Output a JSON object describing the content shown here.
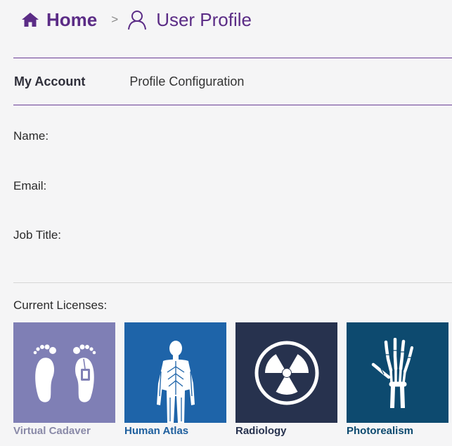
{
  "breadcrumb": {
    "home_icon": "home-icon",
    "home_label": "Home",
    "separator": ">",
    "user_icon": "user-icon",
    "current_label": "User Profile"
  },
  "tabs": [
    {
      "label": "My Account",
      "active": true
    },
    {
      "label": "Profile Configuration",
      "active": false
    }
  ],
  "fields": {
    "name_label": "Name:",
    "email_label": "Email:",
    "job_title_label": "Job Title:"
  },
  "licenses": {
    "heading": "Current Licenses:",
    "items": [
      {
        "label": "Virtual Cadaver",
        "icon": "feet-icon",
        "tile_color": "#7f7fb5",
        "label_color": "#8a8aa8"
      },
      {
        "label": "Human Atlas",
        "icon": "human-body-icon",
        "tile_color": "#1e64a9",
        "label_color": "#1e5f9e"
      },
      {
        "label": "Radiology",
        "icon": "radiation-icon",
        "tile_color": "#27324e",
        "label_color": "#27324e"
      },
      {
        "label": "Photorealism",
        "icon": "hand-xray-icon",
        "tile_color": "#0d4a6f",
        "label_color": "#0d4a6f"
      }
    ]
  },
  "colors": {
    "accent": "#5b2c86",
    "divider": "#6a3d96",
    "background": "#f5f5f6"
  }
}
